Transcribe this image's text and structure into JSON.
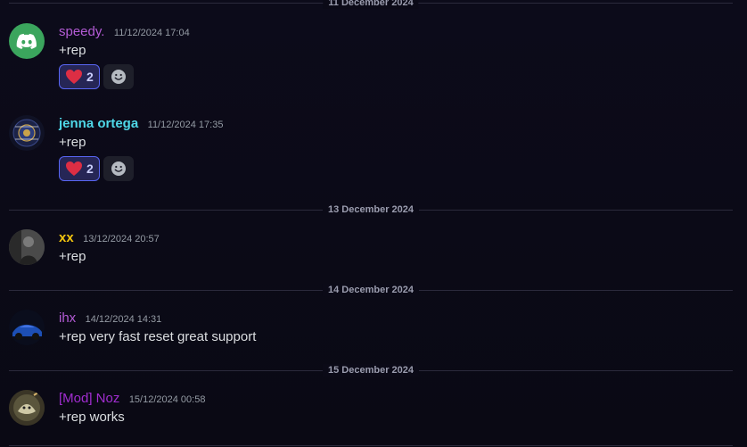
{
  "dividers": [
    {
      "label": "11 December 2024"
    },
    {
      "label": "13 December 2024"
    },
    {
      "label": "14 December 2024"
    },
    {
      "label": "15 December 2024"
    }
  ],
  "messages": [
    {
      "username": "speedy.",
      "timestamp": "11/12/2024 17:04",
      "content": "+rep",
      "name_color": "#b45cd6",
      "reactions": [
        {
          "emoji": "heart",
          "count": "2"
        }
      ]
    },
    {
      "username": "jenna ortega",
      "timestamp": "11/12/2024 17:35",
      "content": "+rep",
      "name_color": "#4fd8e8",
      "reactions": [
        {
          "emoji": "heart",
          "count": "2"
        }
      ]
    },
    {
      "username": "xx",
      "timestamp": "13/12/2024 20:57",
      "content": "+rep",
      "name_color": "#f1c40f"
    },
    {
      "username": "ihx",
      "timestamp": "14/12/2024 14:31",
      "content": "+rep very fast reset great support",
      "name_color": "#b45cd6"
    },
    {
      "username": "[Mod] Noz",
      "timestamp": "15/12/2024 00:58",
      "content": "+rep works",
      "name_color": "#a12dd0"
    }
  ],
  "icons": {
    "reaction": "heart-icon",
    "add_reaction": "smiley-icon",
    "discord": "discord-logo-icon"
  },
  "colors": {
    "background": "#0b0a17",
    "reaction_border": "#5865f2",
    "discord_avatar": "#3ba55d",
    "heart": "#dd2e44"
  }
}
